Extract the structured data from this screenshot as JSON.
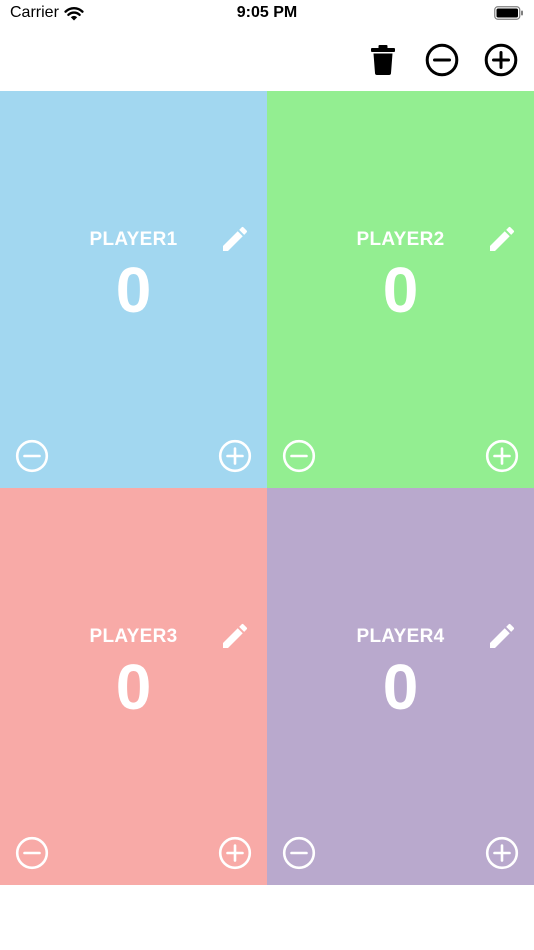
{
  "status_bar": {
    "carrier": "Carrier",
    "time": "9:05 PM"
  },
  "toolbar": {
    "icons": [
      "trash-icon",
      "minus-circle-icon",
      "plus-circle-icon"
    ]
  },
  "players": [
    {
      "name": "PLAYER1",
      "score": "0",
      "color": "#A2D7F0"
    },
    {
      "name": "PLAYER2",
      "score": "0",
      "color": "#93EE91"
    },
    {
      "name": "PLAYER3",
      "score": "0",
      "color": "#F8AAA7"
    },
    {
      "name": "PLAYER4",
      "score": "0",
      "color": "#B9A9CD"
    }
  ]
}
